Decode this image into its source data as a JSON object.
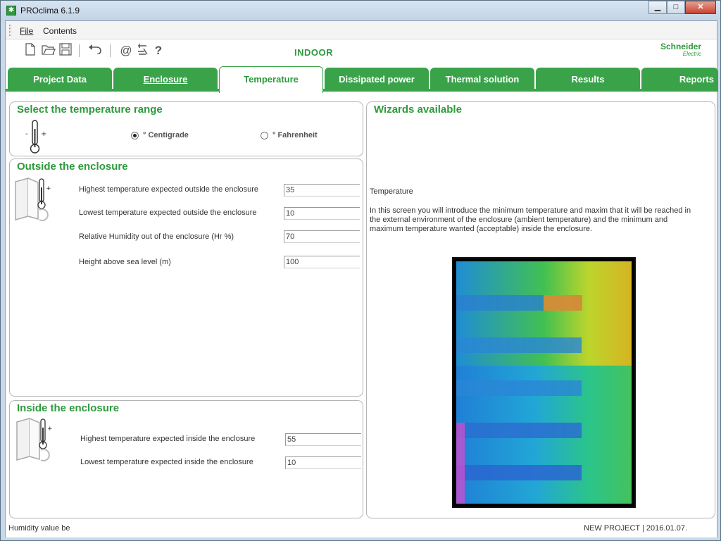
{
  "window": {
    "title": "PROclima 6.1.9"
  },
  "menu": {
    "file": "File",
    "contents": "Contents"
  },
  "toolbar": {
    "section": "INDOOR",
    "brand_line1": "Schneider",
    "brand_line2": "Electric"
  },
  "tabs": [
    {
      "label": "Project Data"
    },
    {
      "label": "Enclosure"
    },
    {
      "label": "Temperature"
    },
    {
      "label": "Dissipated power"
    },
    {
      "label": "Thermal solution"
    },
    {
      "label": "Results"
    },
    {
      "label": "Reports"
    }
  ],
  "temp_range": {
    "title": "Select the temperature range",
    "options": [
      "° Centigrade",
      "° Fahrenheit"
    ],
    "selected": "° Centigrade"
  },
  "outside": {
    "title": "Outside the enclosure",
    "fields": [
      {
        "label": "Highest temperature expected outside the enclosure",
        "value": "35"
      },
      {
        "label": "Lowest temperature expected outside the enclosure",
        "value": "10"
      },
      {
        "label": "Relative Humidity out of the enclosure (Hr %)",
        "value": "70"
      },
      {
        "label": "Height above sea level (m)",
        "value": "100"
      }
    ]
  },
  "inside": {
    "title": "Inside the enclosure",
    "fields": [
      {
        "label": "Highest temperature expected inside the enclosure",
        "value": "55"
      },
      {
        "label": "Lowest temperature expected inside the enclosure",
        "value": "10"
      }
    ]
  },
  "wizards": {
    "title": "Wizards available",
    "heading": "Temperature",
    "body": "In this screen you will introduce the minimum temperature and maxim that it will be reached in the external environment of the enclosure (ambient temperature) and the minimum and maximum temperature wanted (acceptable) inside the enclosure."
  },
  "status": {
    "left": "Humidity value be",
    "right": "NEW PROJECT | 2016.01.07."
  },
  "colors": {
    "accent": "#3aa34a",
    "title_green": "#2e9a3d"
  }
}
